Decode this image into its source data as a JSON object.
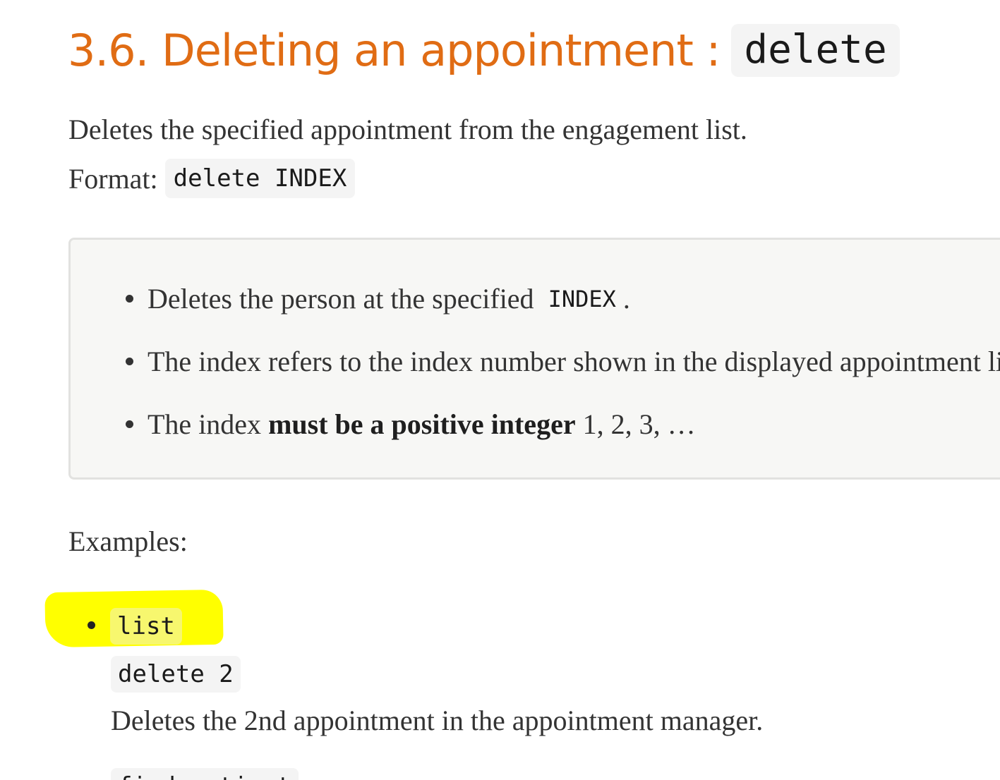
{
  "section": {
    "title": "3.6. Deleting an appointment :",
    "title_code": "delete",
    "description": "Deletes the specified appointment from the engagement list.",
    "format_label": "Format:",
    "format_code": "delete INDEX"
  },
  "callout": {
    "item1_text": "Deletes the person at the specified",
    "item1_code": "INDEX",
    "item1_end": ".",
    "item2_text": "The index refers to the index number shown in the displayed appointment list",
    "item3_pre": "The index",
    "item3_bold": "must be a positive integer",
    "item3_post": "1, 2, 3, …"
  },
  "examples": {
    "label": "Examples:",
    "highlight_color": "#ffff00",
    "item1_code1": "list",
    "item1_code2": "delete 2",
    "item1_desc": "Deletes the 2nd appointment in the appointment manager.",
    "item2_code_partial": "find patient"
  },
  "colors": {
    "heading": "#e06c14",
    "text": "#333333",
    "code_bg": "#f4f4f4",
    "callout_bg": "#f7f7f5"
  }
}
